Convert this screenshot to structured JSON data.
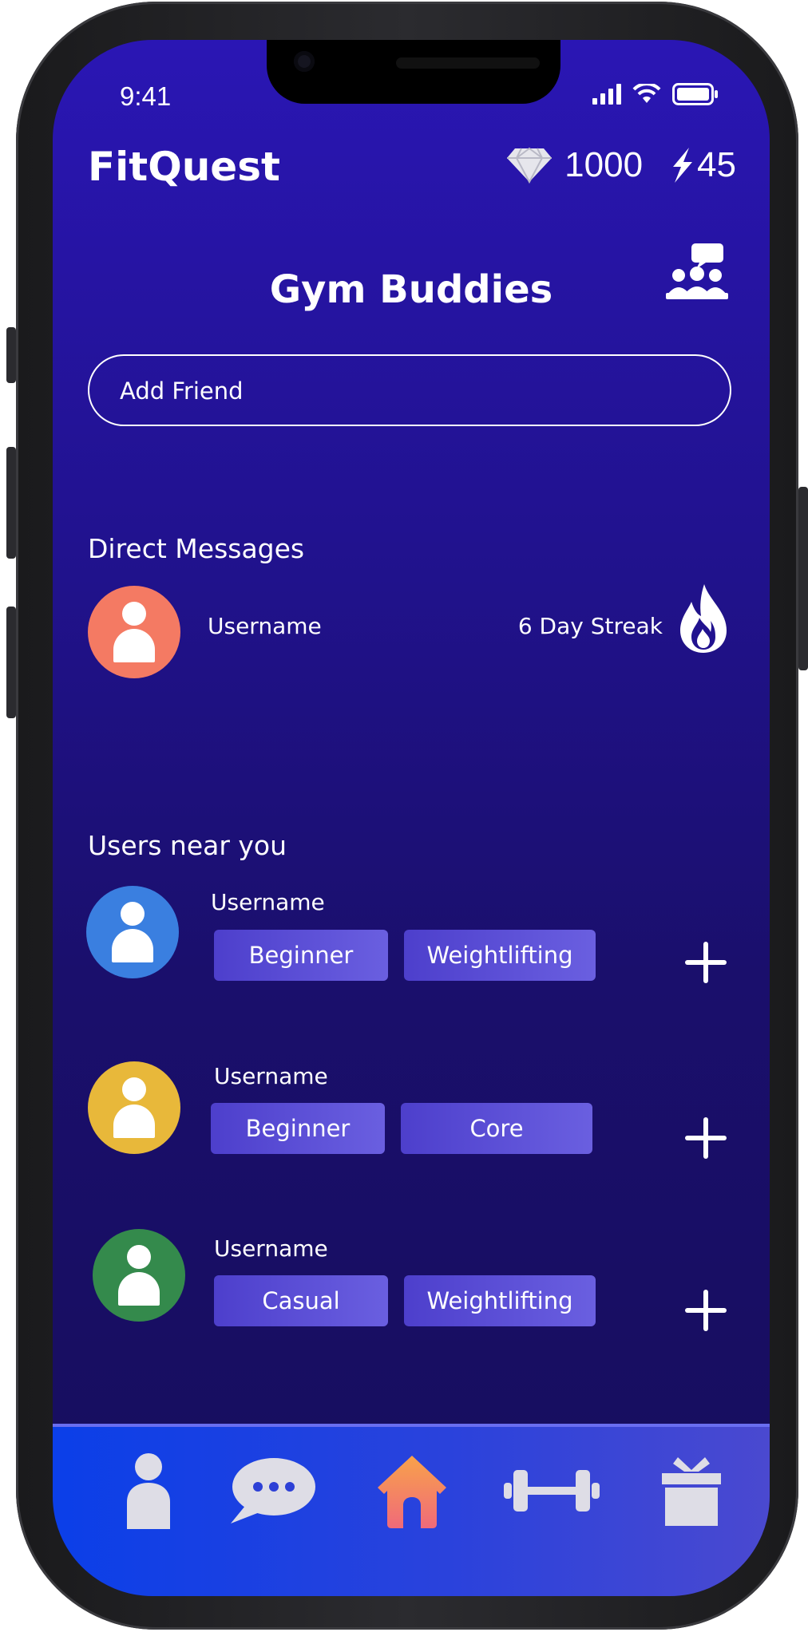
{
  "status_bar": {
    "time": "9:41"
  },
  "header": {
    "app_name": "FitQuest",
    "gems": "1000",
    "energy": "45"
  },
  "page": {
    "title": "Gym Buddies"
  },
  "search": {
    "placeholder": "Add Friend"
  },
  "direct_messages": {
    "title": "Direct Messages",
    "items": [
      {
        "username": "Username",
        "streak": "6 Day Streak",
        "avatar_color": "#f47a63"
      }
    ]
  },
  "nearby": {
    "title": "Users near you",
    "users": [
      {
        "username": "Username",
        "tags": [
          "Beginner",
          "Weightlifting"
        ],
        "avatar_color": "#3a7fe0"
      },
      {
        "username": "Username",
        "tags": [
          "Beginner",
          "Core"
        ],
        "avatar_color": "#e8b83a"
      },
      {
        "username": "Username",
        "tags": [
          "Casual",
          "Weightlifting"
        ],
        "avatar_color": "#348a4c"
      }
    ]
  },
  "tabbar": {
    "items": [
      {
        "icon": "person-icon",
        "active": false
      },
      {
        "icon": "chat-bubble-icon",
        "active": false
      },
      {
        "icon": "home-icon",
        "active": true
      },
      {
        "icon": "dumbbell-icon",
        "active": false
      },
      {
        "icon": "gift-icon",
        "active": false
      }
    ]
  },
  "colors": {
    "accent_home": "#f7904a",
    "background_top": "#2a16b4",
    "background_bottom": "#160d5c",
    "tag": "#5a4fd8"
  }
}
